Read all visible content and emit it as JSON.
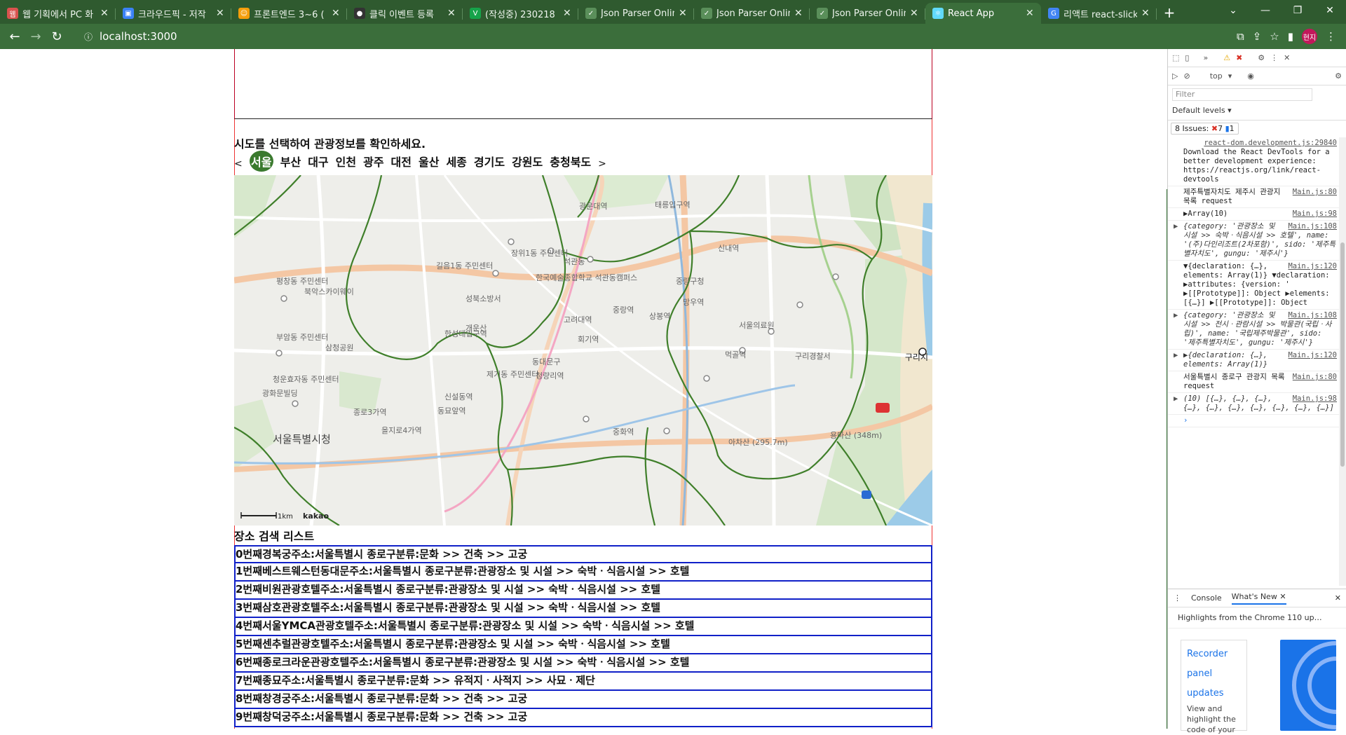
{
  "browser": {
    "tabs": [
      {
        "title": "웹 기획에서 PC 화",
        "color": "#d9534f",
        "glyph": "웹"
      },
      {
        "title": "크라우드픽 - 저작",
        "color": "#3b82f6",
        "glyph": "▣"
      },
      {
        "title": "프론트엔드 3~6 (",
        "color": "#f59e0b",
        "glyph": "☺"
      },
      {
        "title": "클릭 이벤트 등록",
        "color": "#333333",
        "glyph": "●"
      },
      {
        "title": "(작성중) 230218",
        "color": "#16a34a",
        "glyph": "V"
      },
      {
        "title": "Json Parser Online",
        "color": "#5a8f5a",
        "glyph": "✓"
      },
      {
        "title": "Json Parser Online",
        "color": "#5a8f5a",
        "glyph": "✓"
      },
      {
        "title": "Json Parser Online",
        "color": "#5a8f5a",
        "glyph": "✓"
      },
      {
        "title": "React App",
        "color": "#61dafb",
        "glyph": "⚛"
      },
      {
        "title": "리액트 react-slick",
        "color": "#4285f4",
        "glyph": "G"
      }
    ],
    "url": "localhost:3000",
    "avatar_label": "현지"
  },
  "page": {
    "guide_text": "시도를 선택하여 관광정보를 확인하세요.",
    "prev_arrow": "<",
    "next_arrow": ">",
    "sido": [
      "서울",
      "부산",
      "대구",
      "인천",
      "광주",
      "대전",
      "울산",
      "세종",
      "경기도",
      "강원도",
      "충청북도"
    ],
    "selected_sido": "서울",
    "map": {
      "labels": [
        "서울특별시청",
        "성북소방서",
        "개운산",
        "한국예술종합학교 석관동캠퍼스",
        "회기역",
        "중랑역",
        "상봉역",
        "신내역",
        "서울의료원",
        "구리시",
        "아차산 (295.7m)",
        "용마산 (348m)",
        "중랑구청",
        "동대문구",
        "청량리역",
        "신설동역",
        "동묘앞역",
        "종로3가역",
        "을지로4가역",
        "고려대역",
        "삼청공원",
        "북악스카이웨이",
        "부암동 주민센터",
        "평창동 주민센터",
        "길음1동 주민센터",
        "광운대역",
        "태릉입구역",
        "망우역",
        "중화역",
        "먹골역",
        "한성대입구역",
        "제기동 주민센터",
        "청운효자동 주민센터",
        "광화문빌딩",
        "구리경찰서",
        "석관동",
        "장위1동 주민센터"
      ],
      "scale_label": "1km",
      "brand": "kakao"
    },
    "list_title": "장소 검색 리스트",
    "places": [
      "0번째경복궁주소:서울특별시 종로구분류:문화 >> 건축 >> 고궁",
      "1번째베스트웨스턴동대문주소:서울특별시 종로구분류:관광장소 및 시설 >> 숙박ㆍ식음시설 >> 호텔",
      "2번째비원관광호텔주소:서울특별시 종로구분류:관광장소 및 시설 >> 숙박ㆍ식음시설 >> 호텔",
      "3번째삼호관광호텔주소:서울특별시 종로구분류:관광장소 및 시설 >> 숙박ㆍ식음시설 >> 호텔",
      "4번째서울YMCA관광호텔주소:서울특별시 종로구분류:관광장소 및 시설 >> 숙박ㆍ식음시설 >> 호텔",
      "5번째센추럴관광호텔주소:서울특별시 종로구분류:관광장소 및 시설 >> 숙박ㆍ식음시설 >> 호텔",
      "6번째종로크라운관광호텔주소:서울특별시 종로구분류:관광장소 및 시설 >> 숙박ㆍ식음시설 >> 호텔",
      "7번째종묘주소:서울특별시 종로구분류:문화 >> 유적지ㆍ사적지 >> 사묘ㆍ제단",
      "8번째창경궁주소:서울특별시 종로구분류:문화 >> 건축 >> 고궁",
      "9번째창덕궁주소:서울특별시 종로구분류:문화 >> 건축 >> 고궁"
    ]
  },
  "devtools": {
    "context": "top",
    "filter_placeholder": "Filter",
    "levels": "Default levels",
    "issues": "8 Issues:",
    "issues_errors": "7",
    "issues_info": "1",
    "messages": [
      {
        "src": "react-dom.development.js:29840",
        "text": "Download the React DevTools for a better development experience: https://reactjs.org/link/react-devtools",
        "kind": "txt"
      },
      {
        "src": "Main.js:80",
        "text": "제주특별자치도 제주시 관광지 목록 request",
        "kind": "txt"
      },
      {
        "src": "Main.js:98",
        "text": "▶Array(10)",
        "kind": "txt"
      },
      {
        "src": "Main.js:108",
        "text": "{category: '관광장소 및 시설 >> 숙박ㆍ식음시설 >> 호텔', name: '(주)다인리조트(2차포함)', sido: '제주특별자치도', gungu: '제주시'}",
        "kind": "obj"
      },
      {
        "src": "Main.js:120",
        "text": "▼{declaration: {…}, elements: Array(1)}  ▼declaration: ▶attributes: {version: ' ▶[[Prototype]]: Object ▶elements: [{…}] ▶[[Prototype]]: Object",
        "kind": "txt"
      },
      {
        "src": "Main.js:108",
        "text": "{category: '관광장소 및 시설 >> 전시ㆍ관람시설 >> 박물관(국립ㆍ사립)', name: '국립제주박물관', sido: '제주특별자치도', gungu: '제주시'}",
        "kind": "obj"
      },
      {
        "src": "Main.js:120",
        "text": "▶{declaration: {…}, elements: Array(1)}",
        "kind": "obj"
      },
      {
        "src": "Main.js:80",
        "text": "서울특별시 종로구 관광지 목록 request",
        "kind": "txt"
      },
      {
        "src": "Main.js:98",
        "text": "(10) [{…}, {…}, {…}, {…}, {…}, {…}, {…}, {…}, {…}, {…}]",
        "kind": "obj"
      }
    ],
    "drawer_tabs": [
      "Console",
      "What's New"
    ],
    "highlights": "Highlights from the Chrome 110 up…",
    "card_title": [
      "Recorder",
      "panel",
      "updates"
    ],
    "card_desc": "View and highlight the code of your"
  }
}
